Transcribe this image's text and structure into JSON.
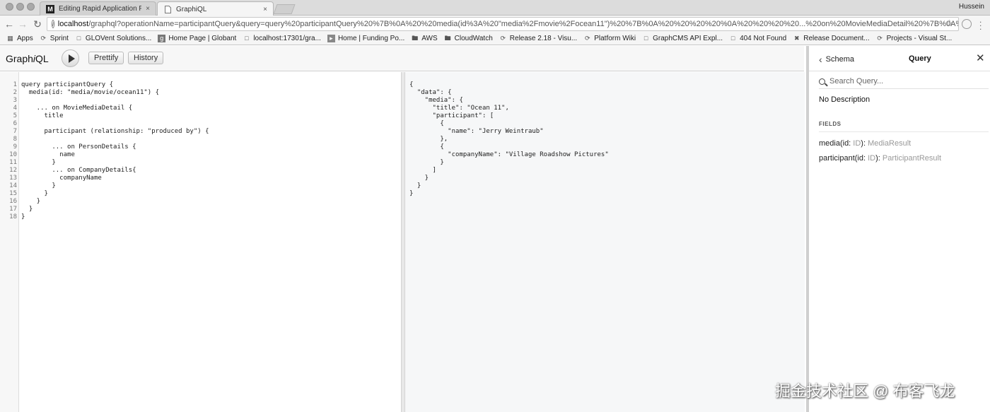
{
  "browser": {
    "tabs": [
      {
        "favicon": "M",
        "title": "Editing Rapid Application Prot",
        "close": "×"
      },
      {
        "favicon": "doc",
        "title": "GraphiQL",
        "close": "×"
      }
    ],
    "user": "Hussein",
    "url_host": "localhost",
    "url_rest": "/graphql?operationName=participantQuery&query=query%20participantQuery%20%7B%0A%20%20media(id%3A%20\"media%2Fmovie%2Focean11\")%20%7B%0A%20%20%20%20%0A%20%20%20%20...%20on%20MovieMediaDetail%20%7B%0A%20...",
    "bookmarks": [
      "Apps",
      "Sprint",
      "GLOVent Solutions...",
      "Home Page | Globant",
      "localhost:17301/gra...",
      "Home | Funding Po...",
      "AWS",
      "CloudWatch",
      "Release 2.18 - Visu...",
      "Platform Wiki",
      "GraphCMS API Expl...",
      "404 Not Found",
      "Release Document...",
      "Projects - Visual St..."
    ]
  },
  "graphiql": {
    "logo_a": "Graph",
    "logo_b": "i",
    "logo_c": "QL",
    "prettify": "Prettify",
    "history": "History"
  },
  "editor": {
    "lines": [
      "query participantQuery {",
      "  media(id: \"media/movie/ocean11\") {",
      "",
      "    ... on MovieMediaDetail {",
      "      title",
      "",
      "      participant (relationship: \"produced by\") {",
      "",
      "        ... on PersonDetails {",
      "          name",
      "        }",
      "        ... on CompanyDetails{",
      "          companyName",
      "        }",
      "      }",
      "    }",
      "  }",
      "}"
    ]
  },
  "result": {
    "lines": [
      "{",
      "  \"data\": {",
      "    \"media\": {",
      "      \"title\": \"Ocean 11\",",
      "      \"participant\": [",
      "        {",
      "          \"name\": \"Jerry Weintraub\"",
      "        },",
      "        {",
      "          \"companyName\": \"Village Roadshow Pictures\"",
      "        }",
      "      ]",
      "    }",
      "  }",
      "}"
    ]
  },
  "docs": {
    "back_label": "Schema",
    "title": "Query",
    "search_placeholder": "Search Query...",
    "description": "No Description",
    "section": "FIELDS",
    "fields": [
      {
        "sig": "media(id: ",
        "arg": "ID",
        "close": "): ",
        "type": "MediaResult"
      },
      {
        "sig": "participant(id: ",
        "arg": "ID",
        "close": "): ",
        "type": "ParticipantResult"
      }
    ]
  },
  "watermark": "掘金技术社区 @ 布客飞龙"
}
